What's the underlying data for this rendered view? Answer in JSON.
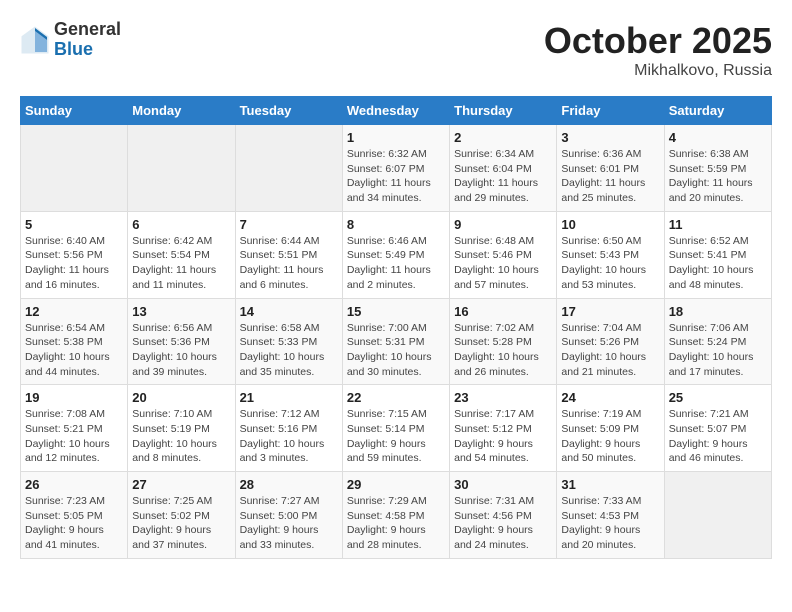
{
  "header": {
    "logo_general": "General",
    "logo_blue": "Blue",
    "month_year": "October 2025",
    "location": "Mikhalkovo, Russia"
  },
  "days_of_week": [
    "Sunday",
    "Monday",
    "Tuesday",
    "Wednesday",
    "Thursday",
    "Friday",
    "Saturday"
  ],
  "weeks": [
    [
      {
        "day": "",
        "info": ""
      },
      {
        "day": "",
        "info": ""
      },
      {
        "day": "",
        "info": ""
      },
      {
        "day": "1",
        "info": "Sunrise: 6:32 AM\nSunset: 6:07 PM\nDaylight: 11 hours\nand 34 minutes."
      },
      {
        "day": "2",
        "info": "Sunrise: 6:34 AM\nSunset: 6:04 PM\nDaylight: 11 hours\nand 29 minutes."
      },
      {
        "day": "3",
        "info": "Sunrise: 6:36 AM\nSunset: 6:01 PM\nDaylight: 11 hours\nand 25 minutes."
      },
      {
        "day": "4",
        "info": "Sunrise: 6:38 AM\nSunset: 5:59 PM\nDaylight: 11 hours\nand 20 minutes."
      }
    ],
    [
      {
        "day": "5",
        "info": "Sunrise: 6:40 AM\nSunset: 5:56 PM\nDaylight: 11 hours\nand 16 minutes."
      },
      {
        "day": "6",
        "info": "Sunrise: 6:42 AM\nSunset: 5:54 PM\nDaylight: 11 hours\nand 11 minutes."
      },
      {
        "day": "7",
        "info": "Sunrise: 6:44 AM\nSunset: 5:51 PM\nDaylight: 11 hours\nand 6 minutes."
      },
      {
        "day": "8",
        "info": "Sunrise: 6:46 AM\nSunset: 5:49 PM\nDaylight: 11 hours\nand 2 minutes."
      },
      {
        "day": "9",
        "info": "Sunrise: 6:48 AM\nSunset: 5:46 PM\nDaylight: 10 hours\nand 57 minutes."
      },
      {
        "day": "10",
        "info": "Sunrise: 6:50 AM\nSunset: 5:43 PM\nDaylight: 10 hours\nand 53 minutes."
      },
      {
        "day": "11",
        "info": "Sunrise: 6:52 AM\nSunset: 5:41 PM\nDaylight: 10 hours\nand 48 minutes."
      }
    ],
    [
      {
        "day": "12",
        "info": "Sunrise: 6:54 AM\nSunset: 5:38 PM\nDaylight: 10 hours\nand 44 minutes."
      },
      {
        "day": "13",
        "info": "Sunrise: 6:56 AM\nSunset: 5:36 PM\nDaylight: 10 hours\nand 39 minutes."
      },
      {
        "day": "14",
        "info": "Sunrise: 6:58 AM\nSunset: 5:33 PM\nDaylight: 10 hours\nand 35 minutes."
      },
      {
        "day": "15",
        "info": "Sunrise: 7:00 AM\nSunset: 5:31 PM\nDaylight: 10 hours\nand 30 minutes."
      },
      {
        "day": "16",
        "info": "Sunrise: 7:02 AM\nSunset: 5:28 PM\nDaylight: 10 hours\nand 26 minutes."
      },
      {
        "day": "17",
        "info": "Sunrise: 7:04 AM\nSunset: 5:26 PM\nDaylight: 10 hours\nand 21 minutes."
      },
      {
        "day": "18",
        "info": "Sunrise: 7:06 AM\nSunset: 5:24 PM\nDaylight: 10 hours\nand 17 minutes."
      }
    ],
    [
      {
        "day": "19",
        "info": "Sunrise: 7:08 AM\nSunset: 5:21 PM\nDaylight: 10 hours\nand 12 minutes."
      },
      {
        "day": "20",
        "info": "Sunrise: 7:10 AM\nSunset: 5:19 PM\nDaylight: 10 hours\nand 8 minutes."
      },
      {
        "day": "21",
        "info": "Sunrise: 7:12 AM\nSunset: 5:16 PM\nDaylight: 10 hours\nand 3 minutes."
      },
      {
        "day": "22",
        "info": "Sunrise: 7:15 AM\nSunset: 5:14 PM\nDaylight: 9 hours\nand 59 minutes."
      },
      {
        "day": "23",
        "info": "Sunrise: 7:17 AM\nSunset: 5:12 PM\nDaylight: 9 hours\nand 54 minutes."
      },
      {
        "day": "24",
        "info": "Sunrise: 7:19 AM\nSunset: 5:09 PM\nDaylight: 9 hours\nand 50 minutes."
      },
      {
        "day": "25",
        "info": "Sunrise: 7:21 AM\nSunset: 5:07 PM\nDaylight: 9 hours\nand 46 minutes."
      }
    ],
    [
      {
        "day": "26",
        "info": "Sunrise: 7:23 AM\nSunset: 5:05 PM\nDaylight: 9 hours\nand 41 minutes."
      },
      {
        "day": "27",
        "info": "Sunrise: 7:25 AM\nSunset: 5:02 PM\nDaylight: 9 hours\nand 37 minutes."
      },
      {
        "day": "28",
        "info": "Sunrise: 7:27 AM\nSunset: 5:00 PM\nDaylight: 9 hours\nand 33 minutes."
      },
      {
        "day": "29",
        "info": "Sunrise: 7:29 AM\nSunset: 4:58 PM\nDaylight: 9 hours\nand 28 minutes."
      },
      {
        "day": "30",
        "info": "Sunrise: 7:31 AM\nSunset: 4:56 PM\nDaylight: 9 hours\nand 24 minutes."
      },
      {
        "day": "31",
        "info": "Sunrise: 7:33 AM\nSunset: 4:53 PM\nDaylight: 9 hours\nand 20 minutes."
      },
      {
        "day": "",
        "info": ""
      }
    ]
  ]
}
